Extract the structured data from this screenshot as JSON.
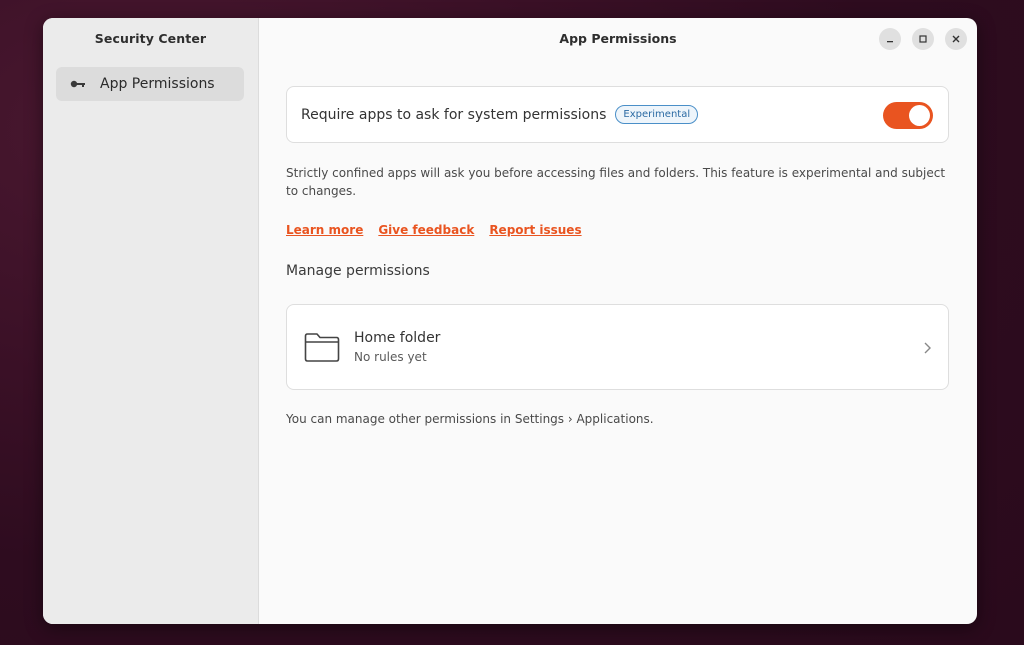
{
  "sidebar": {
    "title": "Security Center",
    "items": [
      {
        "label": "App Permissions",
        "icon": "key-icon",
        "selected": true
      }
    ]
  },
  "header": {
    "title": "App Permissions"
  },
  "window_controls": {
    "minimize": "minimize-icon",
    "maximize": "maximize-icon",
    "close": "close-icon"
  },
  "permission_toggle": {
    "label": "Require apps to ask for system permissions",
    "badge": "Experimental",
    "enabled": true
  },
  "description": "Strictly confined apps will ask you before accessing files and folders. This feature is experimental and subject to changes.",
  "links": {
    "learn_more": "Learn more",
    "give_feedback": "Give feedback",
    "report_issues": "Report issues"
  },
  "manage": {
    "title": "Manage permissions",
    "items": [
      {
        "name": "Home folder",
        "subtitle": "No rules yet",
        "icon": "folder-icon"
      }
    ]
  },
  "footer": "You can manage other permissions in Settings › Applications.",
  "colors": {
    "accent": "#e95420",
    "badge_border": "#4a8fc8",
    "window_bg": "#fafafa",
    "sidebar_bg": "#ebebeb"
  }
}
